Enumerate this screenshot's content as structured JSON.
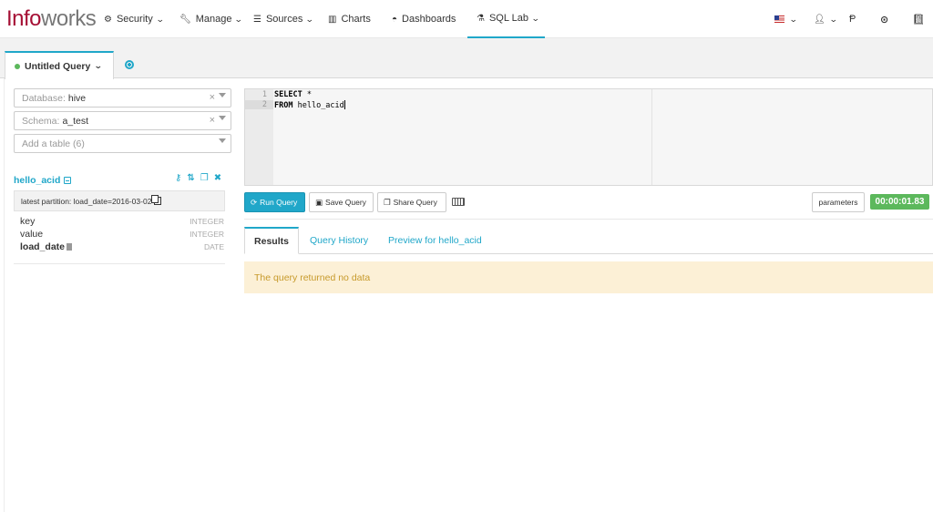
{
  "navbar": {
    "brand": {
      "part1": "Info",
      "part2": "works"
    },
    "items": [
      {
        "label": "Security",
        "icon": "gears-icon",
        "has_dropdown": true
      },
      {
        "label": "Manage",
        "icon": "wrench-icon",
        "has_dropdown": true
      },
      {
        "label": "Sources",
        "icon": "database-icon",
        "has_dropdown": true
      },
      {
        "label": "Charts",
        "icon": "bar-chart-icon",
        "has_dropdown": false
      },
      {
        "label": "Dashboards",
        "icon": "dashboard-icon",
        "has_dropdown": false
      },
      {
        "label": "SQL Lab",
        "icon": "flask-icon",
        "has_dropdown": true
      }
    ],
    "right": {
      "language_icon": "us-flag-icon",
      "user_icon": "user-icon",
      "version_glyph": "Ᵽ",
      "github_icon": "github-icon",
      "docs_icon": "book-icon"
    }
  },
  "query_tabs": [
    {
      "label": "Untitled Query",
      "status_color": "#5cb85c"
    }
  ],
  "left_panel": {
    "database": {
      "label": "Database:",
      "value": "hive"
    },
    "schema": {
      "label": "Schema:",
      "value": "a_test"
    },
    "add_table": {
      "placeholder": "Add a table (6)"
    },
    "table": {
      "name": "hello_acid",
      "partition": "latest partition: load_date=2016-03-02",
      "columns": [
        {
          "name": "key",
          "type": "INTEGER",
          "partition_key": false
        },
        {
          "name": "value",
          "type": "INTEGER",
          "partition_key": false
        },
        {
          "name": "load_date",
          "type": "DATE",
          "partition_key": true
        }
      ]
    }
  },
  "editor": {
    "lines": [
      {
        "num": "1",
        "keyword": "SELECT",
        "rest": " *"
      },
      {
        "num": "2",
        "keyword": "FROM",
        "rest": " hello_acid"
      }
    ]
  },
  "toolbar": {
    "run": "Run Query",
    "save": "Save Query",
    "share": "Share Query",
    "parameters": "parameters",
    "timer": "00:00:01.83"
  },
  "results": {
    "tabs": [
      "Results",
      "Query History",
      "Preview for hello_acid"
    ],
    "message": "The query returned no data"
  },
  "colors": {
    "accent": "#20a7c9",
    "brand": "#a50f34",
    "success": "#5cb85c",
    "warning_bg": "#fcf0d6",
    "warning_text": "#c79a2b"
  }
}
